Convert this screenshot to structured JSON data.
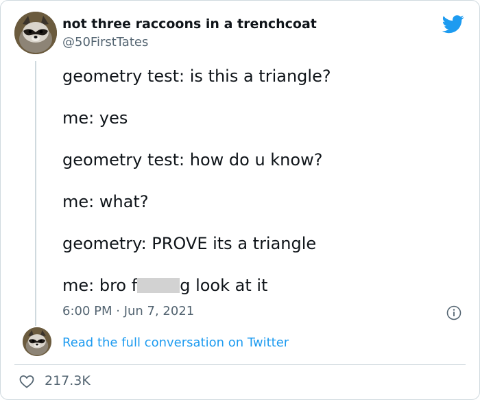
{
  "tweet": {
    "display_name": "not three raccoons in a trenchcoat",
    "handle": "@50FirstTates",
    "lines": [
      "geometry test: is this a triangle?",
      "me: yes",
      "geometry test: how do u know?",
      "me: what?",
      "geometry: PROVE its a triangle"
    ],
    "last_line_prefix": "me: bro f",
    "last_line_suffix": "g look at it",
    "timestamp": "6:00 PM · Jun 7, 2021",
    "read_more": "Read the full conversation on Twitter",
    "likes": "217.3K"
  },
  "icons": {
    "brand": "twitter-bird-icon",
    "info": "info-icon",
    "like": "heart-icon"
  },
  "colors": {
    "twitter_blue": "#1d9bf0",
    "secondary_text": "#536471",
    "border": "#cfd9de"
  }
}
